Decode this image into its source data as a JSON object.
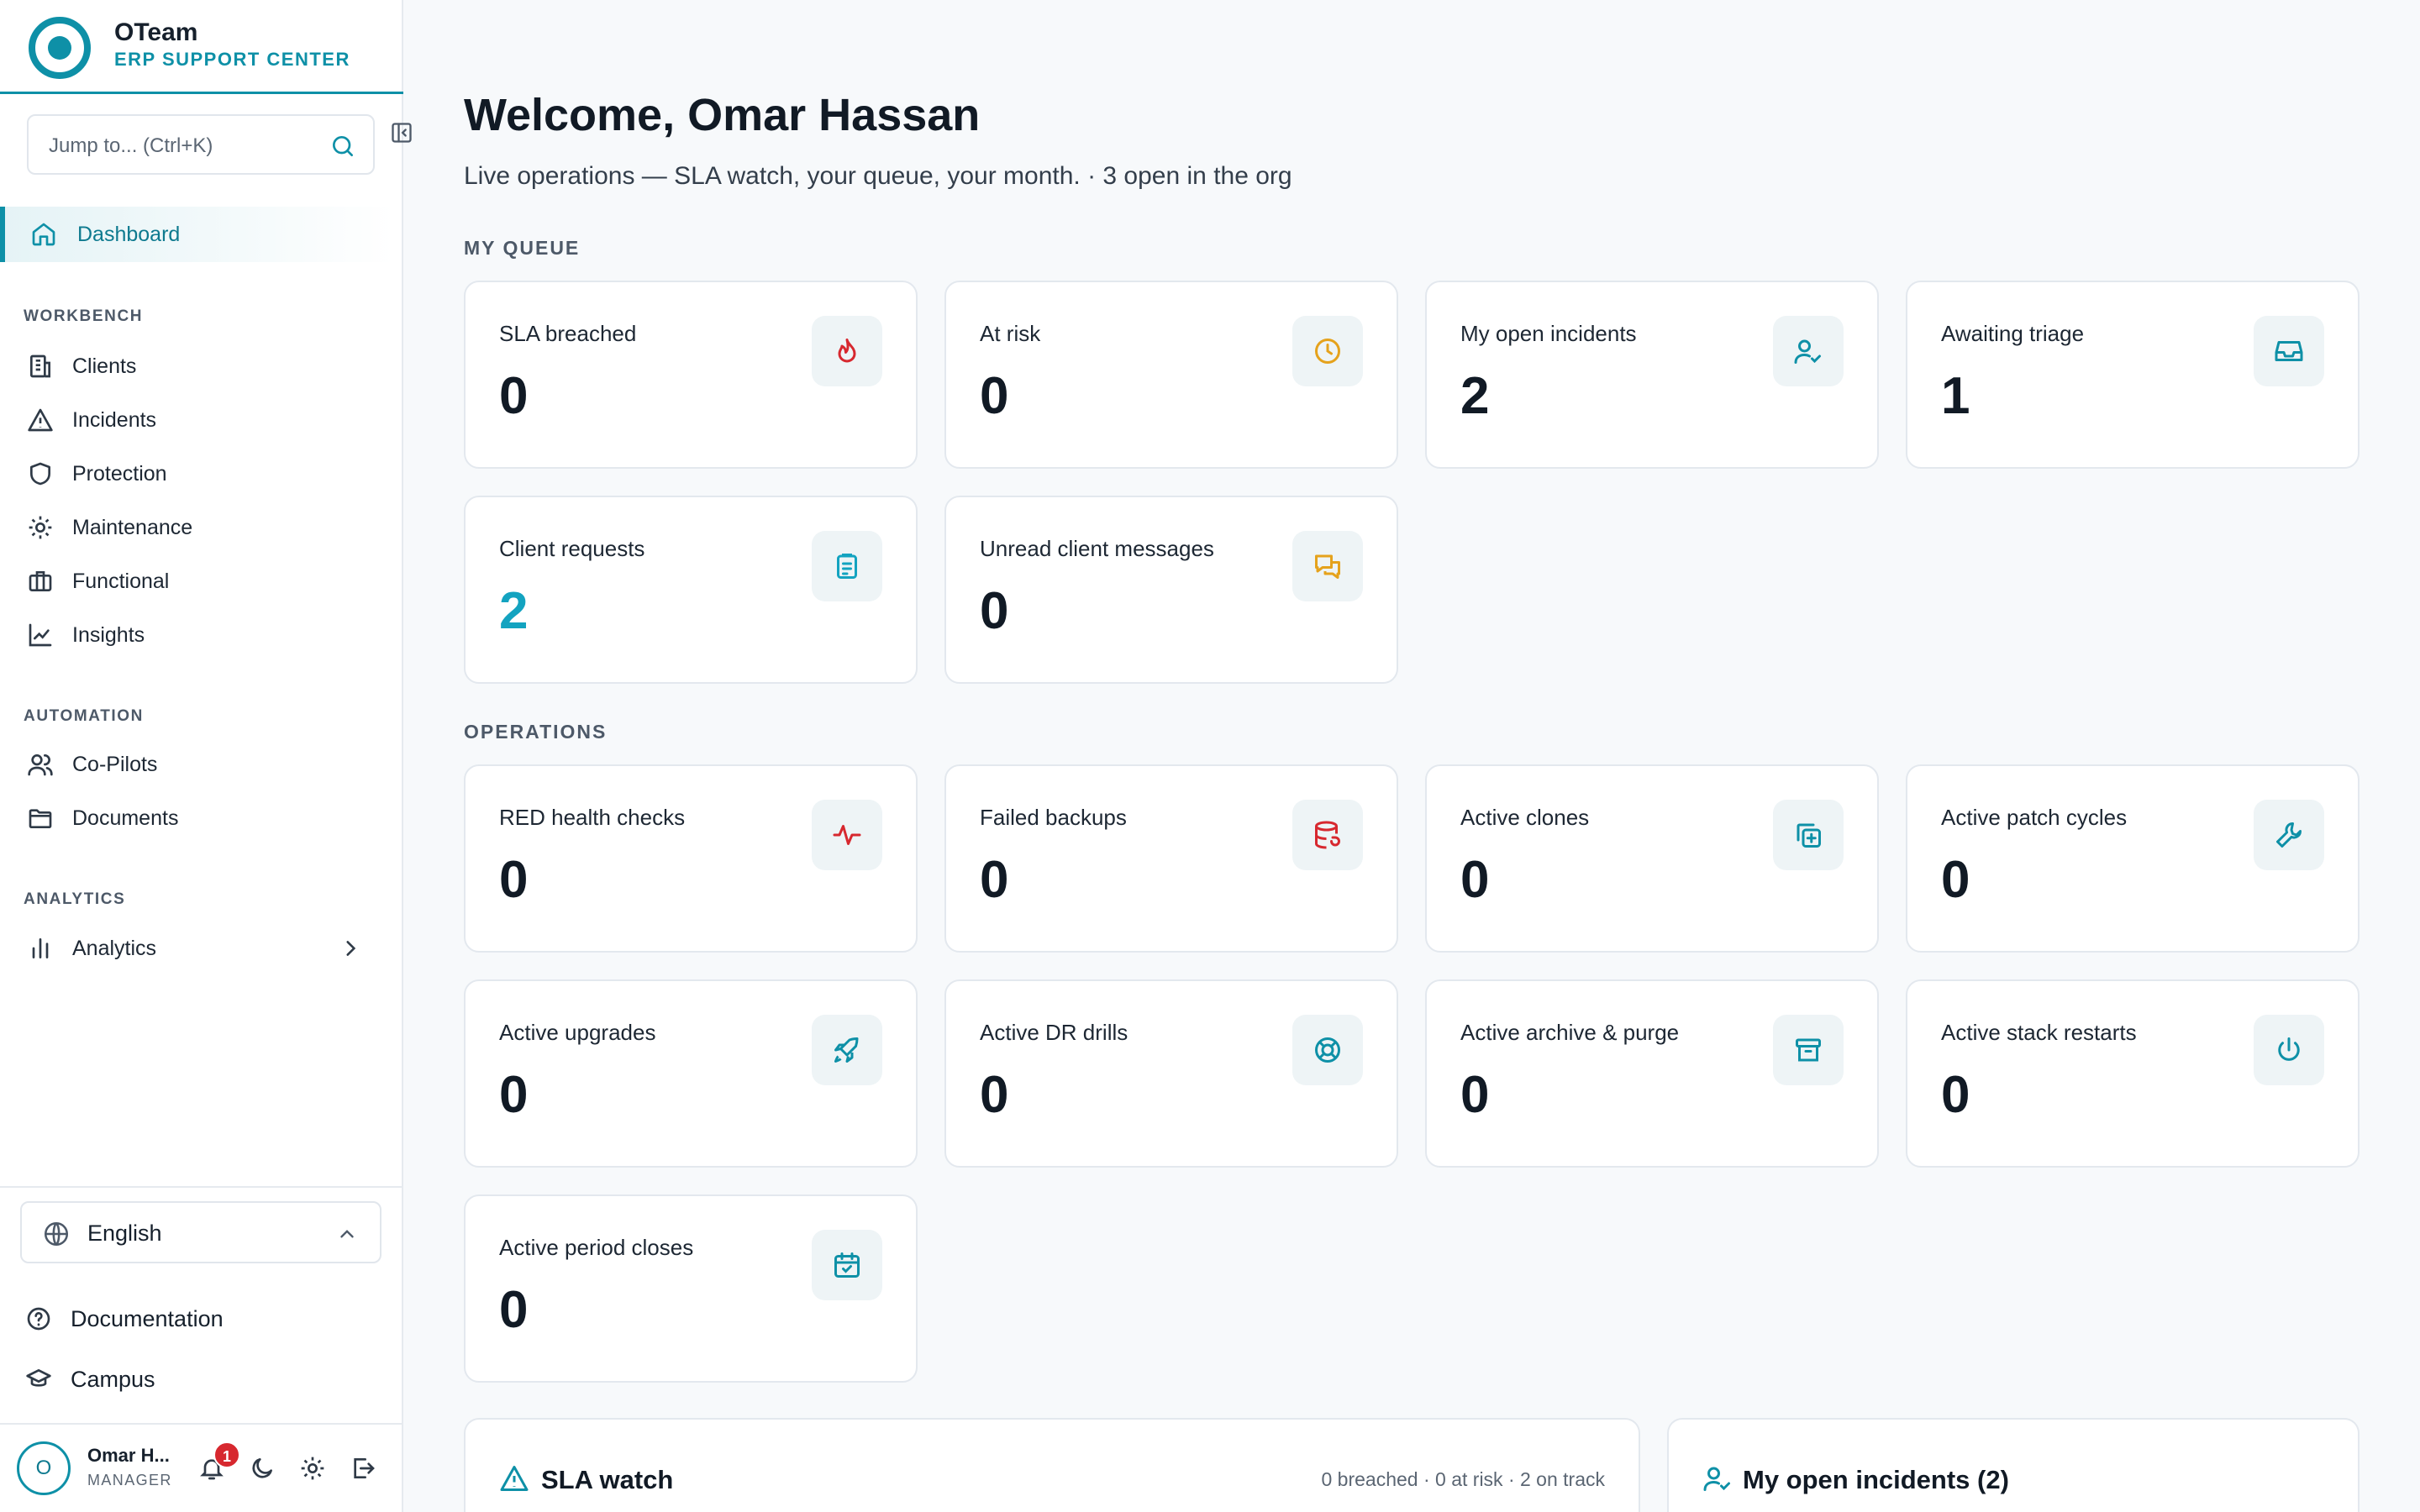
{
  "brand": {
    "name": "OTeam",
    "subtitle": "ERP SUPPORT CENTER"
  },
  "search": {
    "placeholder": "Jump to... (Ctrl+K)"
  },
  "nav": {
    "dashboard": "Dashboard",
    "workbench_heading": "WORKBENCH",
    "workbench": [
      {
        "label": "Clients",
        "icon": "building-icon"
      },
      {
        "label": "Incidents",
        "icon": "warning-icon"
      },
      {
        "label": "Protection",
        "icon": "shield-icon"
      },
      {
        "label": "Maintenance",
        "icon": "gear-icon"
      },
      {
        "label": "Functional",
        "icon": "briefcase-icon"
      },
      {
        "label": "Insights",
        "icon": "chart-line-icon"
      }
    ],
    "automation_heading": "AUTOMATION",
    "automation": [
      {
        "label": "Co-Pilots",
        "icon": "users-icon"
      },
      {
        "label": "Documents",
        "icon": "folder-icon"
      }
    ],
    "analytics_heading": "ANALYTICS",
    "analytics": {
      "label": "Analytics",
      "icon": "bar-chart-icon"
    }
  },
  "footer": {
    "language": "English",
    "documentation": "Documentation",
    "campus": "Campus",
    "user": {
      "initial": "O",
      "name": "Omar H...",
      "role": "MANAGER",
      "notifications": "1"
    }
  },
  "main": {
    "welcome": "Welcome, Omar Hassan",
    "subtitle": "Live operations — SLA watch, your queue, your month. · 3 open in the org",
    "my_queue_heading": "MY QUEUE",
    "my_queue": [
      {
        "title": "SLA breached",
        "value": "0",
        "icon": "flame-icon",
        "color": "#d7282f"
      },
      {
        "title": "At risk",
        "value": "0",
        "icon": "clock-icon",
        "color": "#e5a21c"
      },
      {
        "title": "My open incidents",
        "value": "2",
        "icon": "user-check-icon",
        "color": "#0e90a7"
      },
      {
        "title": "Awaiting triage",
        "value": "1",
        "icon": "inbox-icon",
        "color": "#0e90a7"
      },
      {
        "title": "Client requests",
        "value": "2",
        "icon": "clipboard-icon",
        "color": "#13a3c0"
      },
      {
        "title": "Unread client messages",
        "value": "0",
        "icon": "chat-icon",
        "color": "#e5a21c"
      }
    ],
    "operations_heading": "OPERATIONS",
    "operations": [
      {
        "title": "RED health checks",
        "value": "0",
        "icon": "pulse-icon",
        "color": "#d7282f"
      },
      {
        "title": "Failed backups",
        "value": "0",
        "icon": "database-icon",
        "color": "#d7282f"
      },
      {
        "title": "Active clones",
        "value": "0",
        "icon": "copy-plus-icon",
        "color": "#0e90a7"
      },
      {
        "title": "Active patch cycles",
        "value": "0",
        "icon": "wrench-icon",
        "color": "#0e90a7"
      },
      {
        "title": "Active upgrades",
        "value": "0",
        "icon": "rocket-icon",
        "color": "#0e90a7"
      },
      {
        "title": "Active DR drills",
        "value": "0",
        "icon": "lifebuoy-icon",
        "color": "#0e90a7"
      },
      {
        "title": "Active archive & purge",
        "value": "0",
        "icon": "archive-icon",
        "color": "#0e90a7"
      },
      {
        "title": "Active stack restarts",
        "value": "0",
        "icon": "power-icon",
        "color": "#0e90a7"
      },
      {
        "title": "Active period closes",
        "value": "0",
        "icon": "calendar-check-icon",
        "color": "#0e90a7"
      }
    ],
    "sla_watch": {
      "title": "SLA watch",
      "meta": "0 breached · 0 at risk · 2 on track"
    },
    "my_incidents": {
      "title": "My open incidents (2)"
    }
  }
}
